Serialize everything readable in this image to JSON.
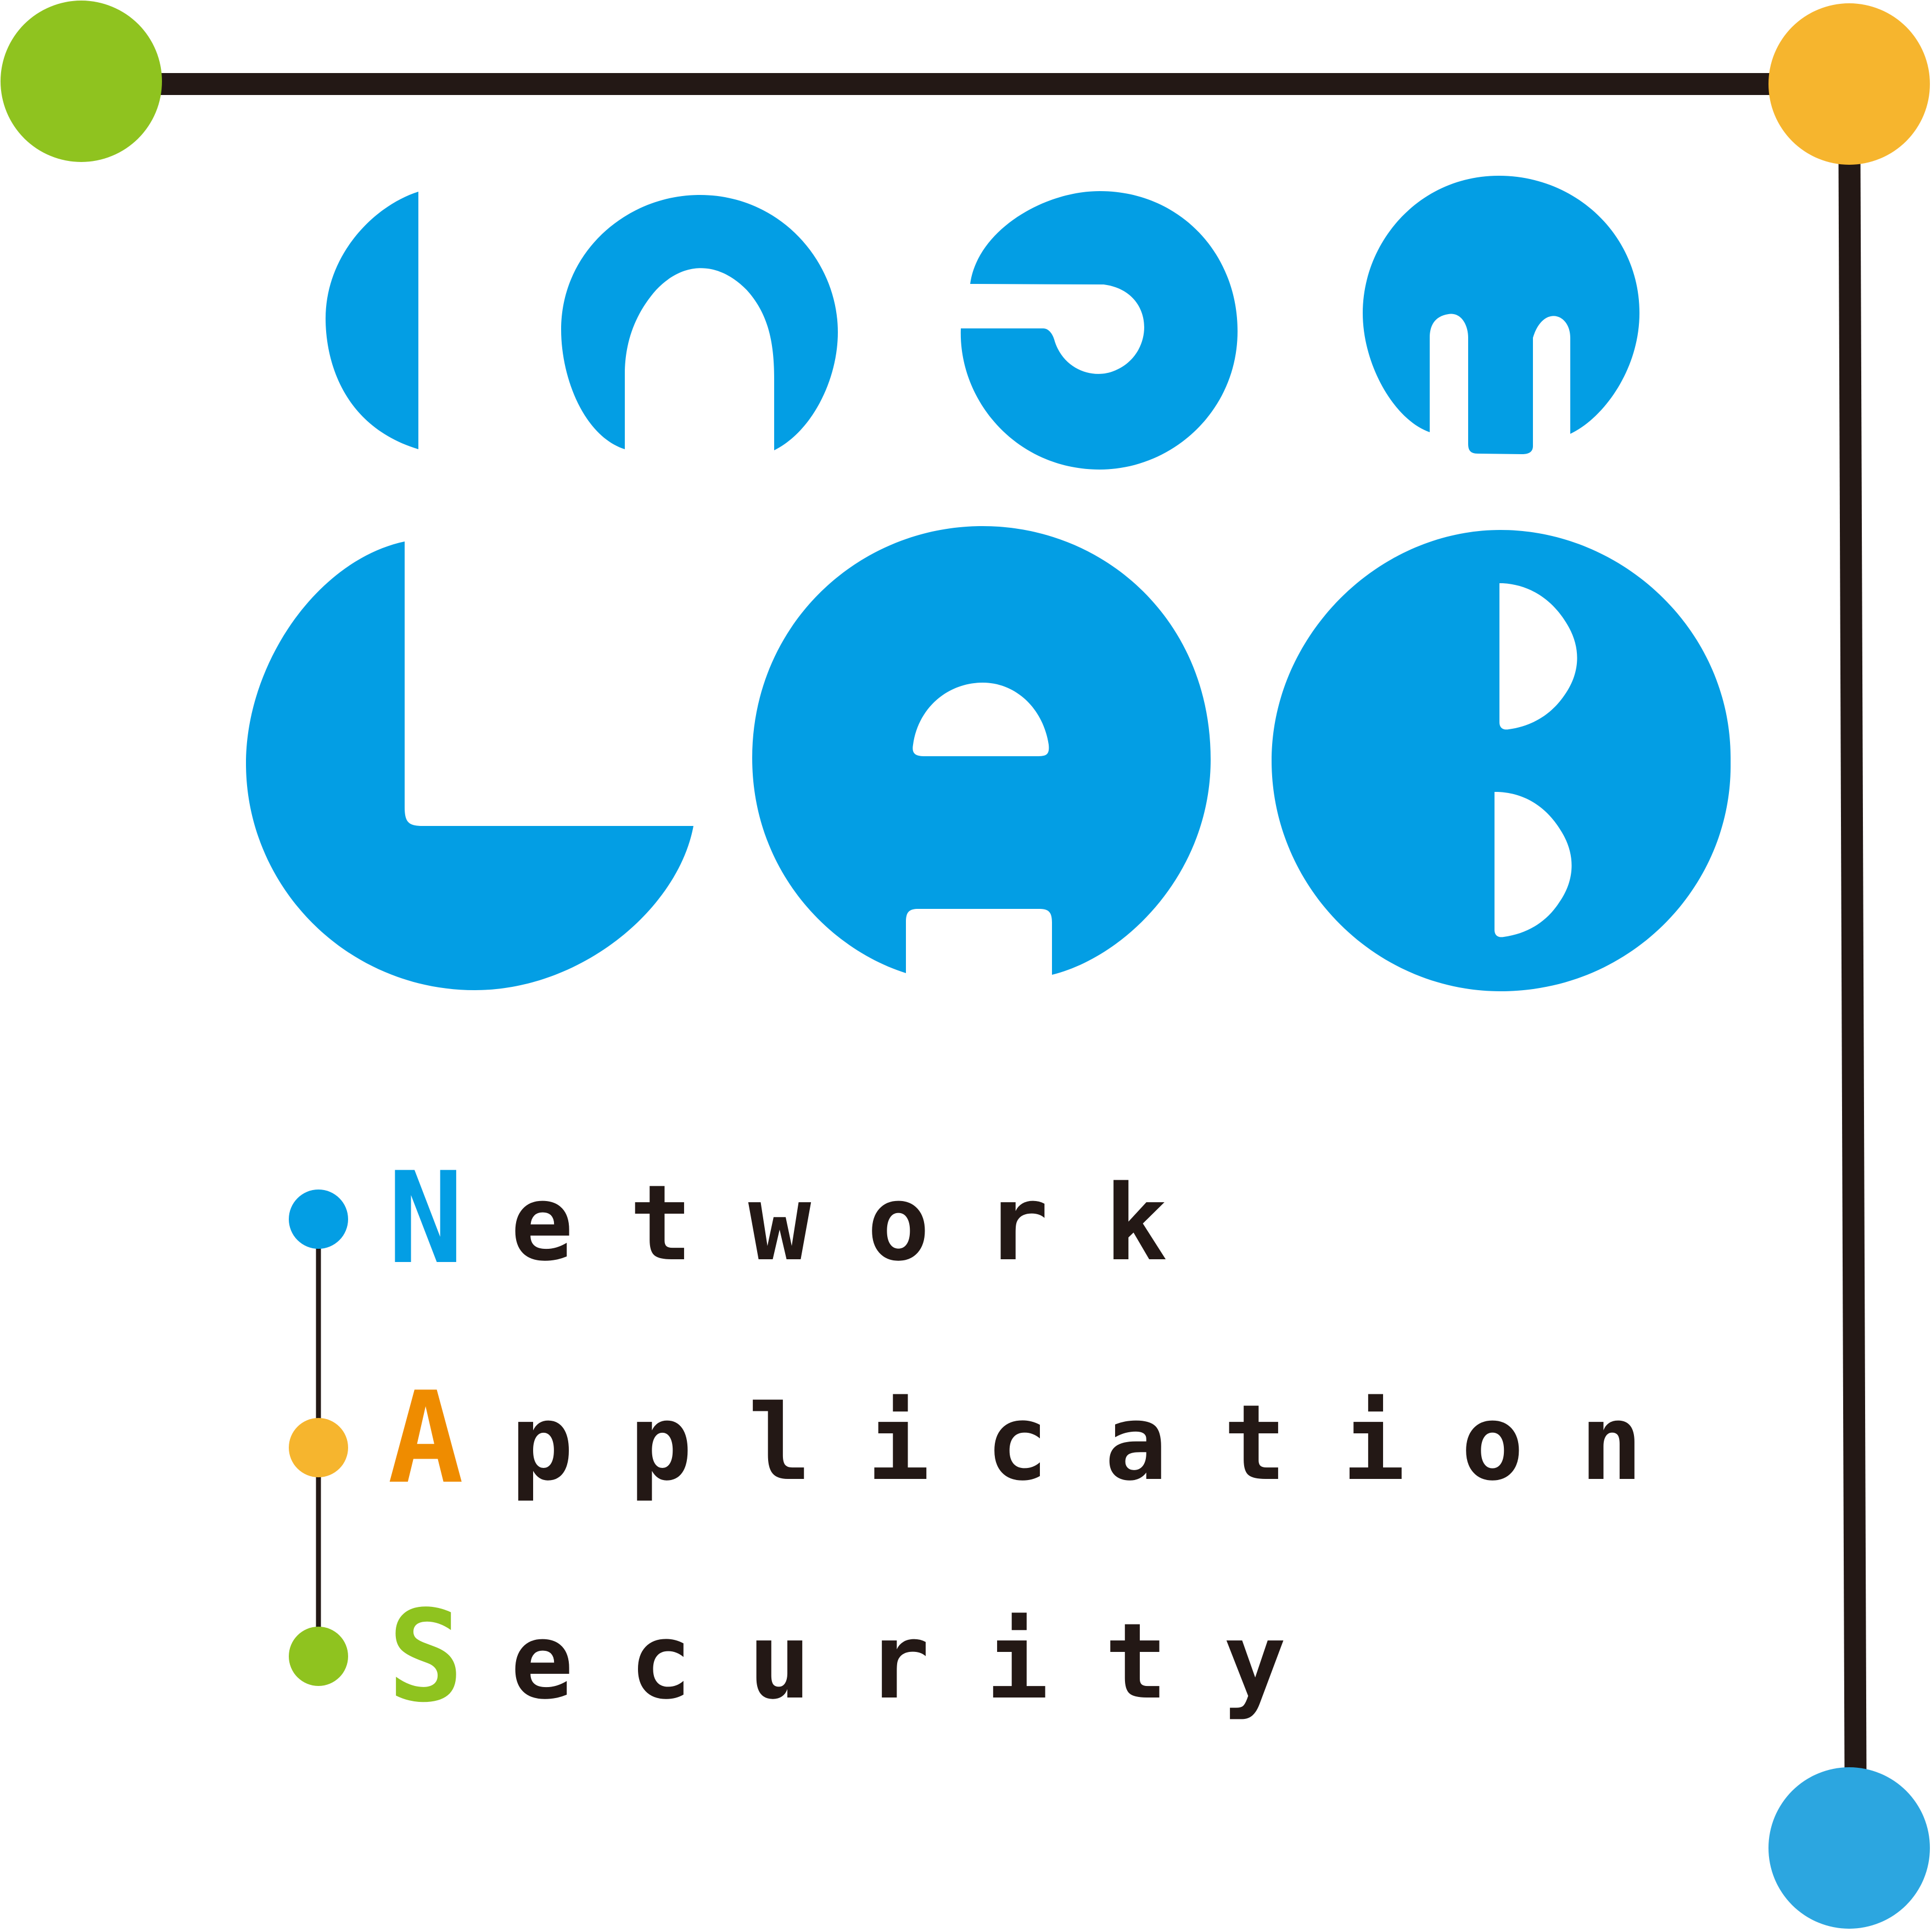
{
  "logo": {
    "name": "Inet Lab",
    "lettering_top": "inet",
    "lettering_bottom": "lab"
  },
  "colors": {
    "logo_blue": "#039ee4",
    "ink": "#231815",
    "green": "#8fc31f",
    "orange": "#f6b52e",
    "amber": "#ef8c00",
    "light_blue": "#2ca6e0"
  },
  "tagline": [
    {
      "initial": "N",
      "rest": "etwork",
      "color": "#039ee4",
      "dot_color": "#039ee4"
    },
    {
      "initial": "A",
      "rest": "pplication",
      "color": "#ef8c00",
      "dot_color": "#f6b52e"
    },
    {
      "initial": "S",
      "rest": "ecurity",
      "color": "#8fc31f",
      "dot_color": "#8fc31f"
    }
  ]
}
